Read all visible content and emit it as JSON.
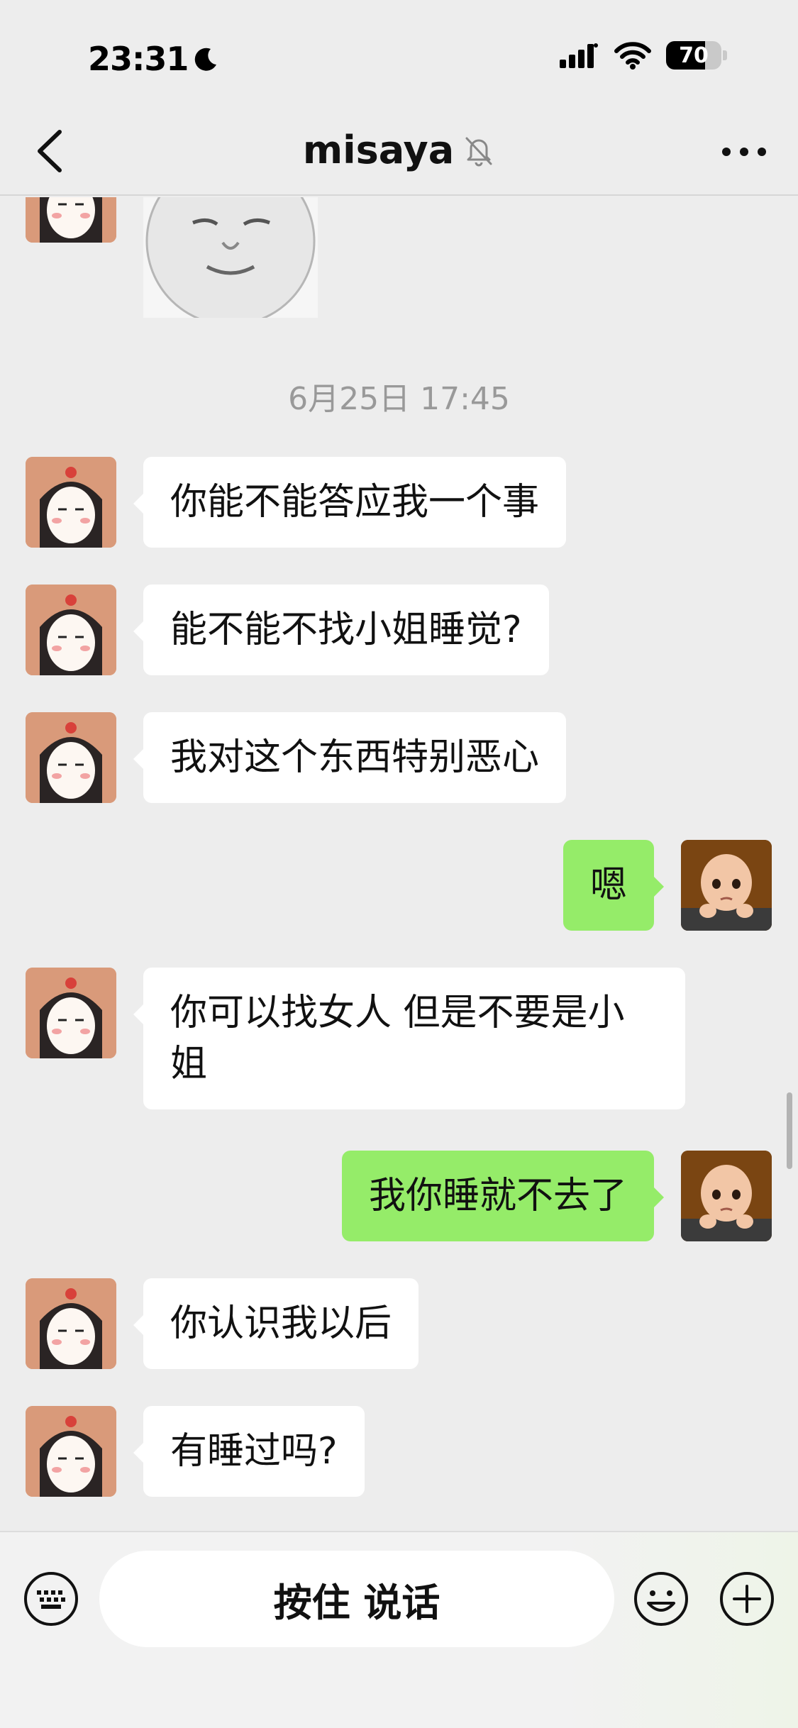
{
  "status_bar": {
    "time": "23:31",
    "battery": "70",
    "battery_level_percent": 70,
    "icons": [
      "moon-icon",
      "signal-icon",
      "wifi-icon",
      "battery-icon"
    ]
  },
  "nav": {
    "back_icon": "chevron-left-icon",
    "title": "misaya",
    "mute_icon": "bell-slash-icon",
    "more_icon": "ellipsis-icon"
  },
  "chat": {
    "timestamp": "6月25日 17:45",
    "messages": [
      {
        "sender": "peer",
        "text": "你能不能答应我一个事"
      },
      {
        "sender": "peer",
        "text": "能不能不找小姐睡觉?"
      },
      {
        "sender": "peer",
        "text": "我对这个东西特别恶心"
      },
      {
        "sender": "self",
        "text": "嗯"
      },
      {
        "sender": "peer",
        "text": "你可以找女人 但是不要是小姐"
      },
      {
        "sender": "self",
        "text": "我你睡就不去了"
      },
      {
        "sender": "peer",
        "text": "你认识我以后"
      },
      {
        "sender": "peer",
        "text": "有睡过吗?"
      }
    ]
  },
  "input_bar": {
    "hold_to_talk": "按住 说话",
    "icons": [
      "keyboard-icon",
      "emoji-icon",
      "plus-icon"
    ]
  },
  "colors": {
    "background": "#ededed",
    "self_bubble": "#95ec69",
    "peer_bubble": "#ffffff",
    "timestamp_text": "#999999"
  }
}
